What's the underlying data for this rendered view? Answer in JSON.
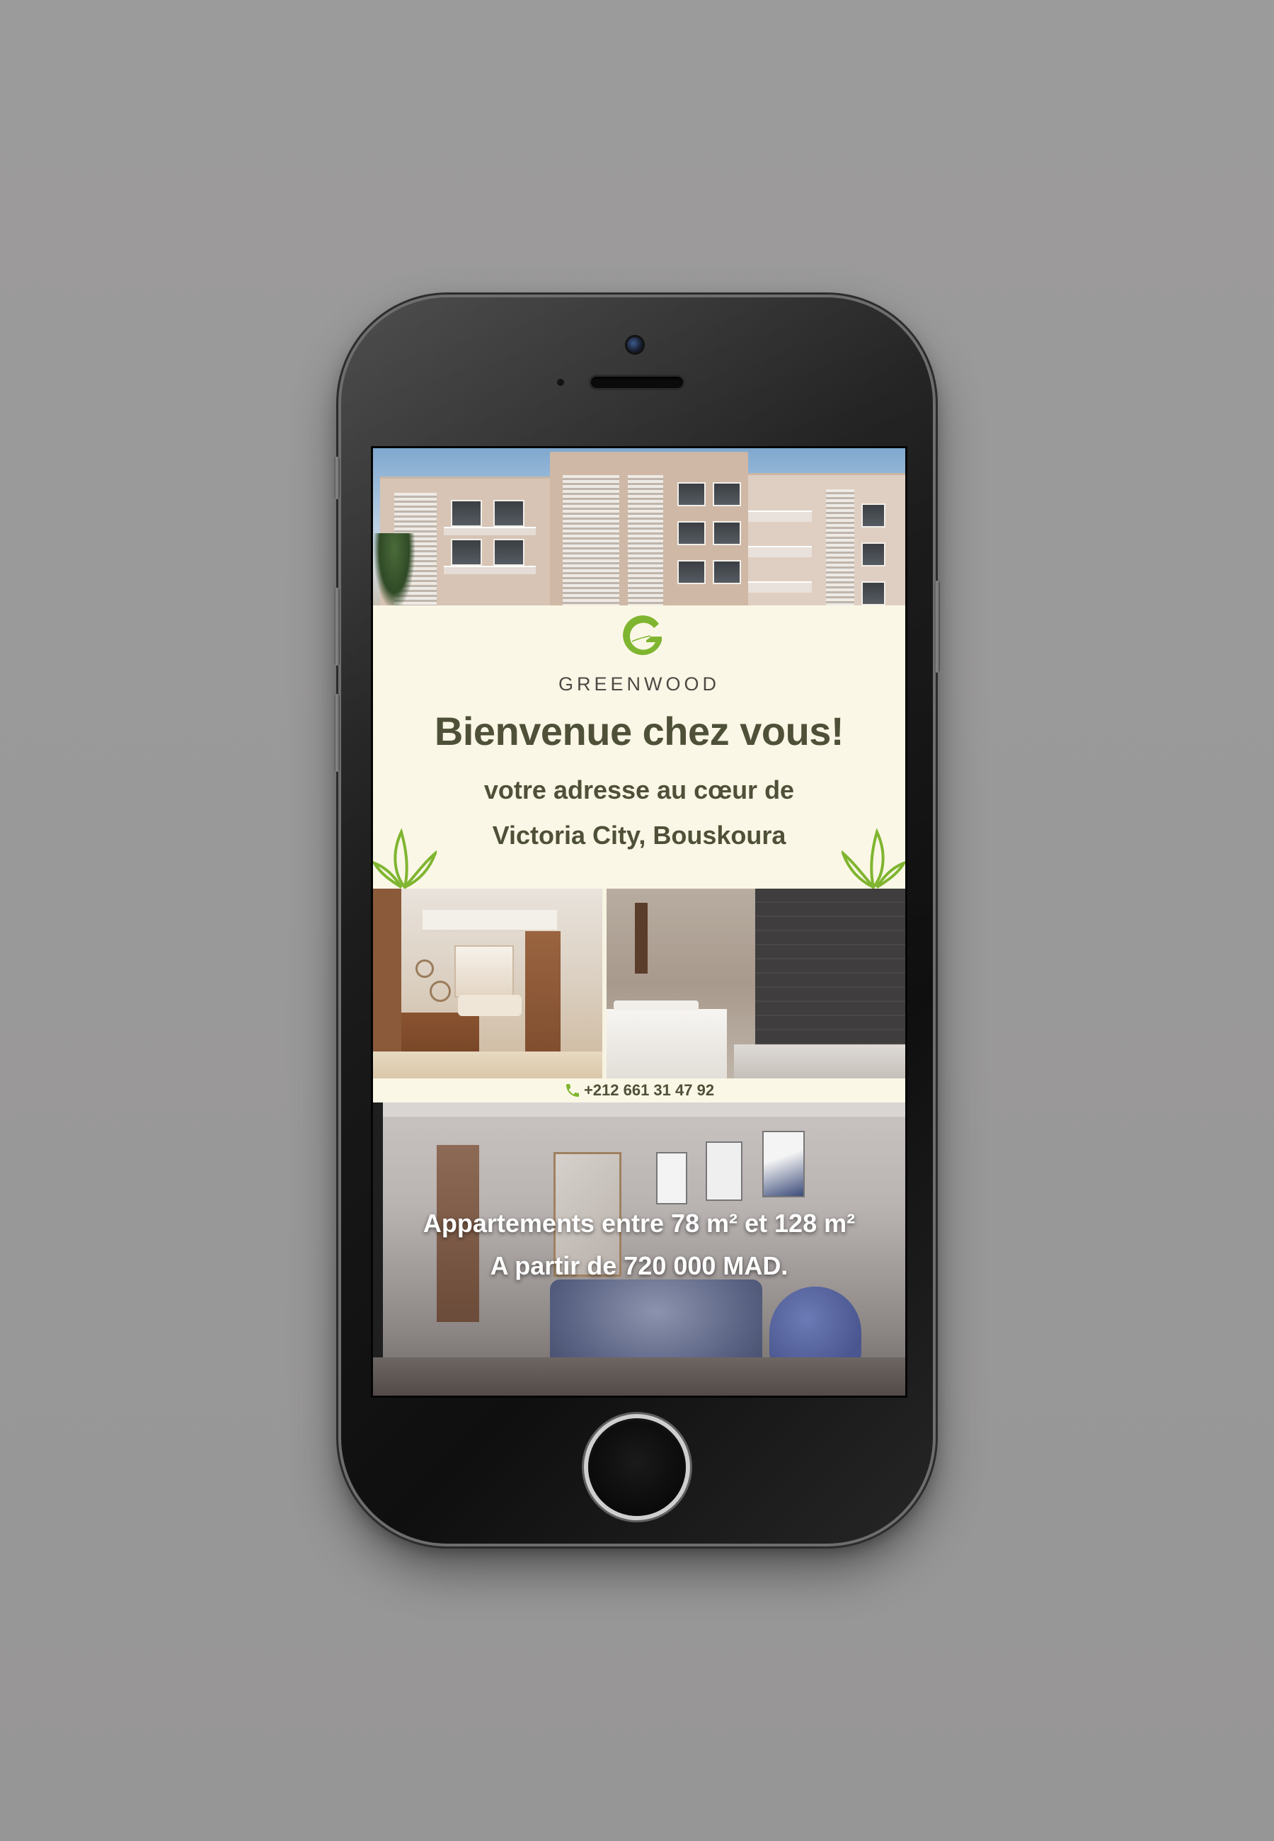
{
  "brand": {
    "name": "GREENWOOD",
    "logo_color": "#7fb530"
  },
  "hero": {
    "headline": "Bienvenue chez vous!",
    "subline_1": "votre adresse au cœur de",
    "subline_2": "Victoria City, Bouskoura"
  },
  "contact": {
    "phone": "+212  661 31 47 92",
    "icon": "phone-icon"
  },
  "offer": {
    "line_1": "Appartements entre 78 m² et 128 m²",
    "line_2": "A partir de 720 000 MAD."
  },
  "colors": {
    "background": "#9b9a9a",
    "cream": "#fbf7e6",
    "olive_text": "#4f5038",
    "accent_green": "#7fb530"
  }
}
